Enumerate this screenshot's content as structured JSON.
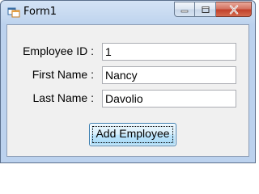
{
  "window": {
    "title": "Form1",
    "icon": "winforms-app-icon",
    "controls": {
      "minimize_icon": "minimize-icon",
      "maximize_icon": "maximize-icon",
      "close_icon": "close-icon"
    }
  },
  "form": {
    "employee_id": {
      "label": "Employee ID :",
      "value": "1"
    },
    "first_name": {
      "label": "First Name :",
      "value": "Nancy"
    },
    "last_name": {
      "label": "Last Name :",
      "value": "Davolio"
    },
    "add_button": "Add Employee"
  },
  "colors": {
    "title_gradient": "#c2d6ef",
    "client_background": "#f0f0f0",
    "close_button": "#c2412b",
    "button_border": "#3c7fb1"
  }
}
